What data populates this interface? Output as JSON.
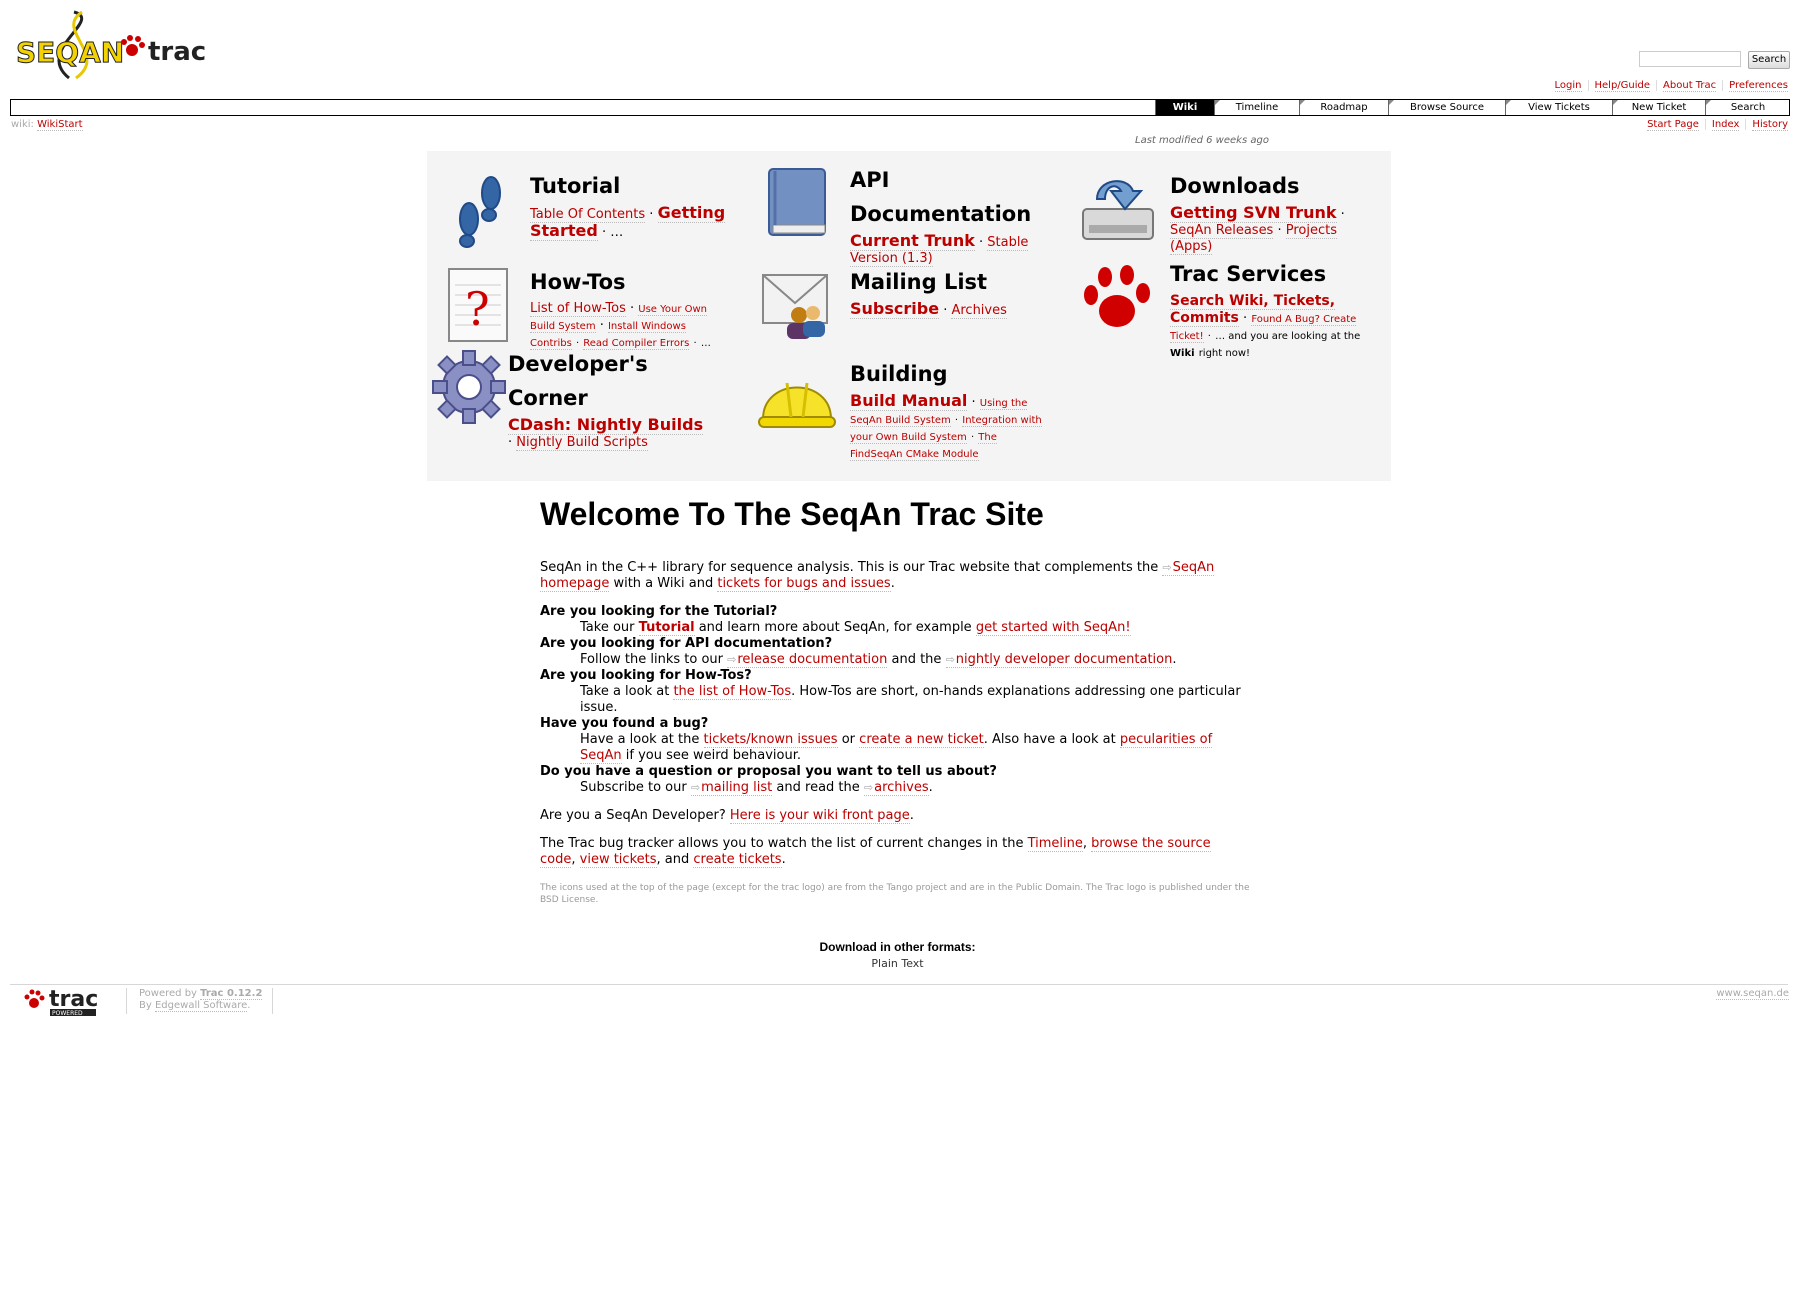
{
  "header": {
    "logo_text_left": "SEQAN",
    "logo_text_right": "trac",
    "search_button": "Search"
  },
  "metanav": [
    "Login",
    "Help/Guide",
    "About Trac",
    "Preferences"
  ],
  "mainnav": [
    "Wiki",
    "Timeline",
    "Roadmap",
    "Browse Source",
    "View Tickets",
    "New Ticket",
    "Search"
  ],
  "breadcrumb": {
    "prefix": "wiki:",
    "page": "WikiStart"
  },
  "ctxtnav": [
    "Start Page",
    "Index",
    "History"
  ],
  "last_modified": "Last modified 6 weeks ago",
  "grid": {
    "tutorial": {
      "title": "Tutorial",
      "l1": "Table Of Contents",
      "l2": "Getting Started",
      "tail": "…"
    },
    "api": {
      "title": "API Documentation",
      "l1": "Current Trunk",
      "l2": "Stable Version (1.3)"
    },
    "downloads": {
      "title": "Downloads",
      "l1": "Getting SVN Trunk",
      "l2": "SeqAn Releases",
      "l3": "Projects (Apps)"
    },
    "howtos": {
      "title": "How-Tos",
      "l1": "List of How-Tos",
      "l2": "Use Your Own Build System",
      "l3": "Install Windows Contribs",
      "l4": "Read Compiler Errors",
      "tail": "…"
    },
    "mailing": {
      "title": "Mailing List",
      "l1": "Subscribe",
      "l2": "Archives"
    },
    "trac": {
      "title": "Trac Services",
      "l1": "Search Wiki, Tickets, Commits",
      "l2": "Found A Bug? Create Ticket!",
      "t1": "… and you are looking at the",
      "t2": "Wiki",
      "t3": "right now!"
    },
    "dev": {
      "title": "Developer's Corner",
      "l1": "CDash: Nightly Builds",
      "l2": "Nightly Build Scripts"
    },
    "building": {
      "title": "Building",
      "l1": "Build Manual",
      "l2": "Using the SeqAn Build System",
      "l3": "Integration with your Own Build System",
      "l4": "The FindSeqAn CMake Module"
    }
  },
  "content": {
    "title": "Welcome To The SeqAn Trac Site",
    "intro_a": "SeqAn in the C++ library for sequence analysis. This is our Trac website that complements the",
    "intro_link1": "SeqAn homepage",
    "intro_b": "with a Wiki and",
    "intro_link2": "tickets for bugs and issues",
    "intro_c": ".",
    "q1": "Are you looking for the Tutorial?",
    "a1_a": "Take our",
    "a1_link1": "Tutorial",
    "a1_b": "and learn more about SeqAn, for example",
    "a1_link2": "get started with SeqAn!",
    "q2": "Are you looking for API documentation?",
    "a2_a": "Follow the links to our",
    "a2_link1": "release documentation",
    "a2_b": "and the",
    "a2_link2": "nightly developer documentation",
    "a2_c": ".",
    "q3": "Are you looking for How-Tos?",
    "a3_a": "Take a look at",
    "a3_link1": "the list of How-Tos",
    "a3_b": ". How-Tos are short, on-hands explanations addressing one particular issue.",
    "q4": "Have you found a bug?",
    "a4_a": "Have a look at the",
    "a4_link1": "tickets/known issues",
    "a4_b": "or",
    "a4_link2": "create a new ticket",
    "a4_c": ". Also have a look at",
    "a4_link3": "pecularities of SeqAn",
    "a4_d": "if you see weird behaviour.",
    "q5": "Do you have a question or proposal you want to tell us about?",
    "a5_a": "Subscribe to our",
    "a5_link1": "mailing list",
    "a5_b": "and read the",
    "a5_link2": "archives",
    "a5_c": ".",
    "dev_a": "Are you a SeqAn Developer?",
    "dev_link": "Here is your wiki front page",
    "dev_b": ".",
    "trac_a": "The Trac bug tracker allows you to watch the list of current changes in the",
    "trac_link1": "Timeline",
    "trac_b": ",",
    "trac_link2": "browse the source code",
    "trac_c": ",",
    "trac_link3": "view tickets",
    "trac_d": ", and",
    "trac_link4": "create tickets",
    "trac_e": ".",
    "note": "The icons used at the top of the page (except for the trac logo) are from the Tango project and are in the Public Domain. The Trac logo is published under the BSD License."
  },
  "altformats": {
    "heading": "Download in other formats:",
    "format": "Plain Text"
  },
  "footer": {
    "powered_a": "Powered by",
    "powered_link": "Trac 0.12.2",
    "by_a": "By",
    "by_link": "Edgewall Software",
    "by_b": ".",
    "site": "www.seqan.de",
    "logo_text": "trac",
    "logo_sub": "POWERED"
  },
  "colors": {
    "link": "#bb0000",
    "nav_active": "#000000",
    "grid_bg": "#f4f4f4"
  }
}
